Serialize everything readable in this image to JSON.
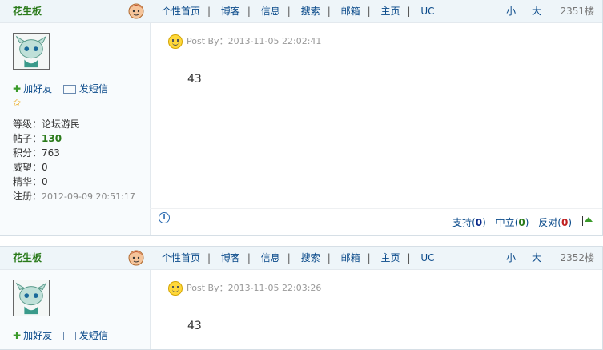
{
  "nav": {
    "items": [
      "个性首页",
      "博客",
      "信息",
      "搜索",
      "邮箱",
      "主页",
      "UC"
    ],
    "font_small": "小",
    "font_large": "大"
  },
  "posts": [
    {
      "username": "花生板",
      "actions": {
        "add_friend": "加好友",
        "send_message": "发短信"
      },
      "stats": {
        "level_label": "等级：",
        "level_value": "论坛游民",
        "posts_label": "帖子：",
        "posts_value": "130",
        "points_label": "积分：",
        "points_value": "763",
        "prestige_label": "威望：",
        "prestige_value": "0",
        "essence_label": "精华：",
        "essence_value": "0",
        "reg_label": "注册：",
        "reg_value": "2012-09-09 20:51:17"
      },
      "floor": "2351楼",
      "post_by": "Post By：2013-11-05 22:02:41",
      "content": "43",
      "votes": {
        "support_label": "支持",
        "support": "0",
        "neutral_label": "中立",
        "neutral": "0",
        "oppose_label": "反对",
        "oppose": "0"
      }
    },
    {
      "username": "花生板",
      "actions": {
        "add_friend": "加好友",
        "send_message": "发短信"
      },
      "floor": "2352楼",
      "post_by": "Post By：2013-11-05 22:03:26",
      "content": "43"
    }
  ]
}
